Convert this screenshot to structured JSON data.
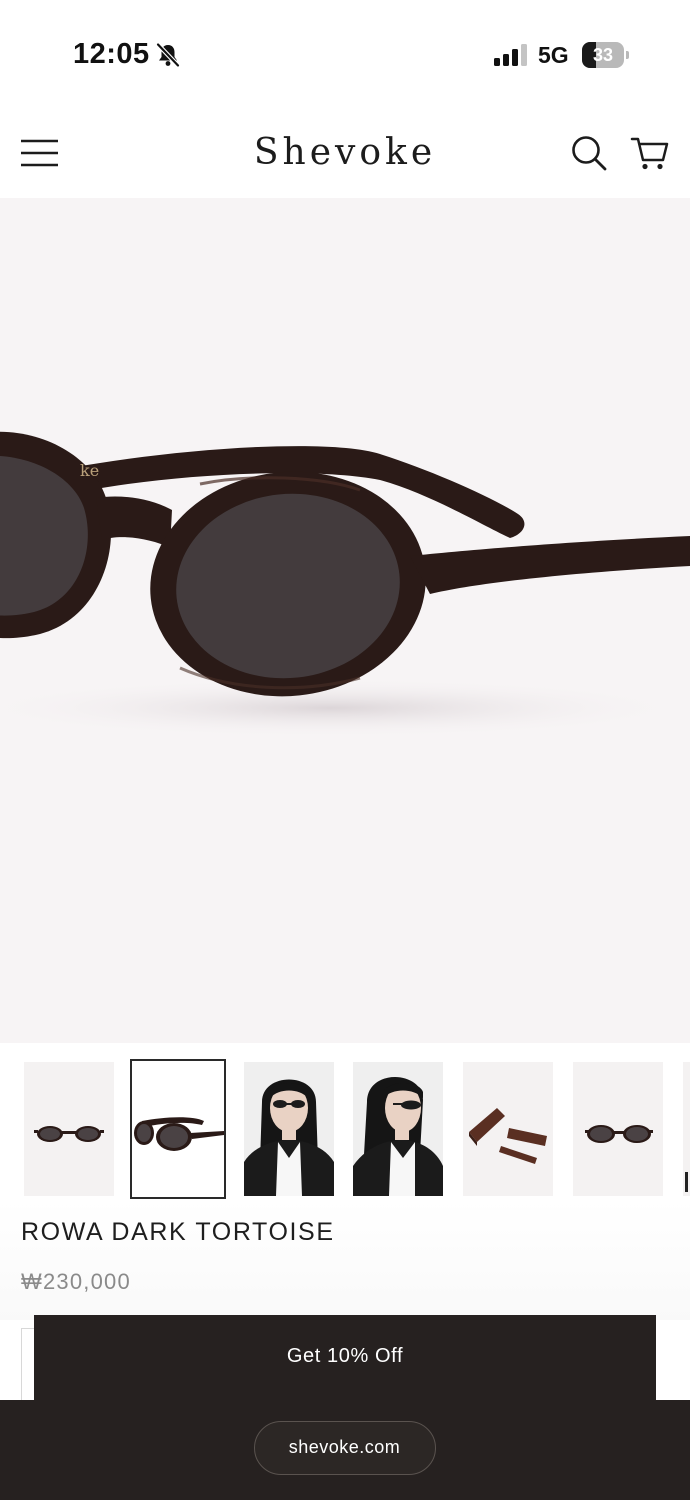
{
  "status_bar": {
    "time": "12:05",
    "network": "5G",
    "battery_percent": "33",
    "battery_level": 0.33,
    "bell_icon": "bell-slash-icon",
    "signal_icon": "cellular-signal-icon"
  },
  "header": {
    "brand": "Shevoke",
    "menu_icon": "hamburger-menu-icon",
    "search_icon": "search-icon",
    "cart_icon": "cart-icon"
  },
  "hero": {
    "background": "#f7f4f5",
    "frame_color": "#2a1a17",
    "lens_color": "#433b3d",
    "temple_print": "ke"
  },
  "thumbnails": {
    "selected_index": 1,
    "items": [
      {
        "kind": "front-view"
      },
      {
        "kind": "side-view"
      },
      {
        "kind": "model-front"
      },
      {
        "kind": "model-side"
      },
      {
        "kind": "case-packaging"
      },
      {
        "kind": "front-view-alt"
      }
    ]
  },
  "product": {
    "title": "ROWA DARK TORTOISE",
    "price": "₩230,000"
  },
  "promo": {
    "label": "Get 10% Off",
    "background": "#262120"
  },
  "browser": {
    "url": "shevoke.com"
  }
}
